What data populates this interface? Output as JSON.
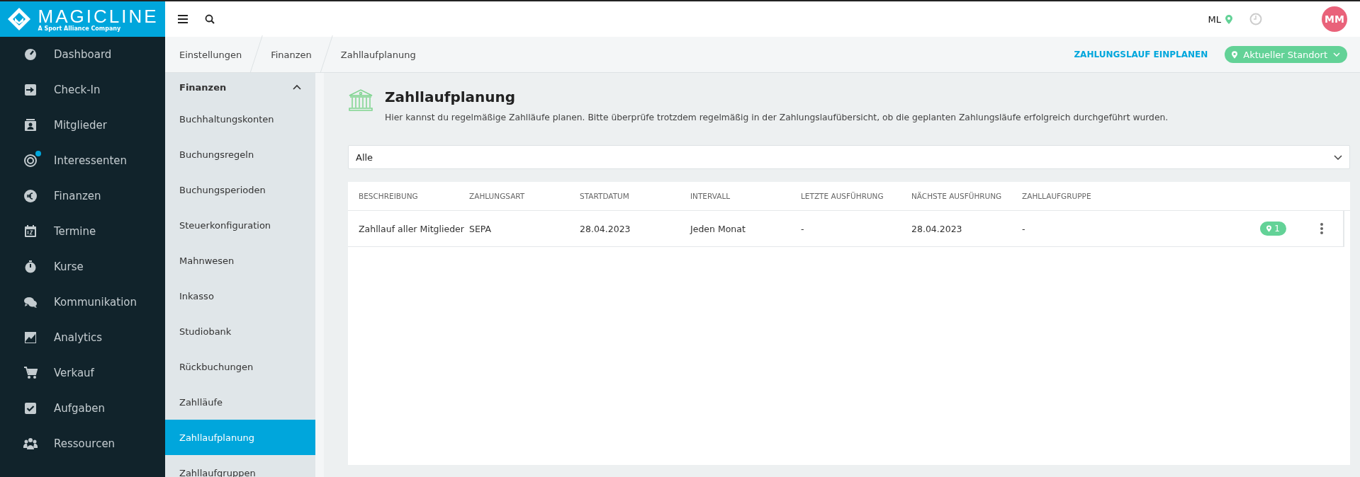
{
  "brand": {
    "name": "MAGICLINE",
    "tagline": "A Sport Alliance Company"
  },
  "nav": [
    {
      "label": "Dashboard",
      "badge": false
    },
    {
      "label": "Check-In",
      "badge": false
    },
    {
      "label": "Mitglieder",
      "badge": false
    },
    {
      "label": "Interessenten",
      "badge": true
    },
    {
      "label": "Finanzen",
      "badge": false
    },
    {
      "label": "Termine",
      "badge": false
    },
    {
      "label": "Kurse",
      "badge": false
    },
    {
      "label": "Kommunikation",
      "badge": false
    },
    {
      "label": "Analytics",
      "badge": false
    },
    {
      "label": "Verkauf",
      "badge": false
    },
    {
      "label": "Aufgaben",
      "badge": false
    },
    {
      "label": "Ressourcen",
      "badge": false
    }
  ],
  "topbar": {
    "studio": "ML",
    "avatar": "MM"
  },
  "breadcrumbs": [
    "Einstellungen",
    "Finanzen",
    "Zahllaufplanung"
  ],
  "actions": {
    "schedule": "ZAHLUNGSLAUF EINPLANEN",
    "location": "Aktueller Standort"
  },
  "submenu": {
    "title": "Finanzen",
    "expanded": true,
    "items": [
      {
        "label": "Buchhaltungskonten",
        "selected": false
      },
      {
        "label": "Buchungsregeln",
        "selected": false
      },
      {
        "label": "Buchungsperioden",
        "selected": false
      },
      {
        "label": "Steuerkonfiguration",
        "selected": false
      },
      {
        "label": "Mahnwesen",
        "selected": false
      },
      {
        "label": "Inkasso",
        "selected": false
      },
      {
        "label": "Studiobank",
        "selected": false
      },
      {
        "label": "Rückbuchungen",
        "selected": false
      },
      {
        "label": "Zahlläufe",
        "selected": false
      },
      {
        "label": "Zahllaufplanung",
        "selected": true
      },
      {
        "label": "Zahllaufgruppen",
        "selected": false
      }
    ]
  },
  "page": {
    "title": "Zahllaufplanung",
    "description": "Hier kannst du regelmäßige Zahlläufe planen. Bitte überprüfe trotzdem regelmäßig in der Zahlungslaufübersicht, ob die geplanten Zahlungsläufe erfolgreich durchgeführt wurden."
  },
  "filter": {
    "value": "Alle"
  },
  "table": {
    "columns": [
      "BESCHREIBUNG",
      "ZAHLUNGSART",
      "STARTDATUM",
      "INTERVALL",
      "LETZTE AUSFÜHRUNG",
      "NÄCHSTE AUSFÜHRUNG",
      "ZAHLLAUFGRUPPE"
    ],
    "rows": [
      {
        "cells": [
          "Zahllauf aller Mitglieder",
          "SEPA",
          "28.04.2023",
          "Jeden Monat",
          "-",
          "28.04.2023",
          "-"
        ],
        "locations": "1"
      }
    ]
  }
}
